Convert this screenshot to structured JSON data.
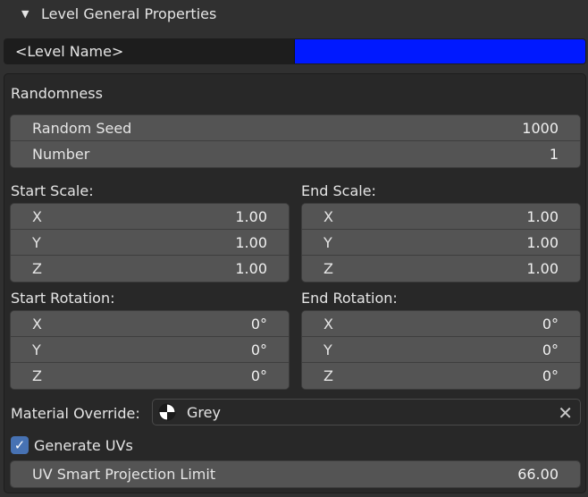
{
  "header": {
    "title": "Level General Properties",
    "arrow": "▼"
  },
  "level": {
    "name": "<Level Name>",
    "color": "#0019ff"
  },
  "randomness": {
    "heading": "Randomness",
    "seed": {
      "label": "Random Seed",
      "value": "1000"
    },
    "number": {
      "label": "Number",
      "value": "1"
    }
  },
  "start_scale": {
    "heading": "Start Scale:",
    "x": {
      "label": "X",
      "value": "1.00"
    },
    "y": {
      "label": "Y",
      "value": "1.00"
    },
    "z": {
      "label": "Z",
      "value": "1.00"
    }
  },
  "end_scale": {
    "heading": "End Scale:",
    "x": {
      "label": "X",
      "value": "1.00"
    },
    "y": {
      "label": "Y",
      "value": "1.00"
    },
    "z": {
      "label": "Z",
      "value": "1.00"
    }
  },
  "start_rotation": {
    "heading": "Start Rotation:",
    "x": {
      "label": "X",
      "value": "0°"
    },
    "y": {
      "label": "Y",
      "value": "0°"
    },
    "z": {
      "label": "Z",
      "value": "0°"
    }
  },
  "end_rotation": {
    "heading": "End Rotation:",
    "x": {
      "label": "X",
      "value": "0°"
    },
    "y": {
      "label": "Y",
      "value": "0°"
    },
    "z": {
      "label": "Z",
      "value": "0°"
    }
  },
  "material": {
    "label": "Material Override:",
    "value": "Grey",
    "icon": "material-icon",
    "clear": "✕"
  },
  "uvs": {
    "label": "Generate UVs",
    "checked": true,
    "check_glyph": "✓",
    "limit": {
      "label": "UV Smart Projection Limit",
      "value": "66.00"
    }
  }
}
